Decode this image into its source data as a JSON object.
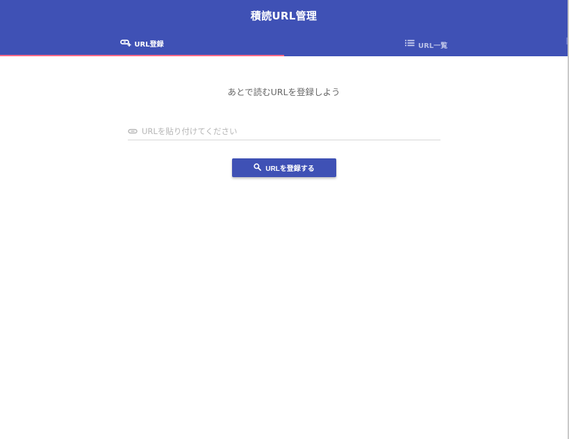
{
  "app": {
    "title": "積読URL管理"
  },
  "tabs": [
    {
      "label": "URL登録",
      "icon": "add-link-icon",
      "active": true
    },
    {
      "label": "URL一覧",
      "icon": "list-icon",
      "active": false
    }
  ],
  "register": {
    "prompt": "あとで読むURLを登録しよう",
    "input_placeholder": "URLを貼り付けてください",
    "input_value": "",
    "input_icon": "link-icon",
    "button_label": "URLを登録する",
    "button_icon": "search-icon"
  },
  "colors": {
    "primary": "#3f51b5",
    "tab_indicator": "#ff6a88",
    "inactive_tab_text": "#b9c0e6"
  }
}
